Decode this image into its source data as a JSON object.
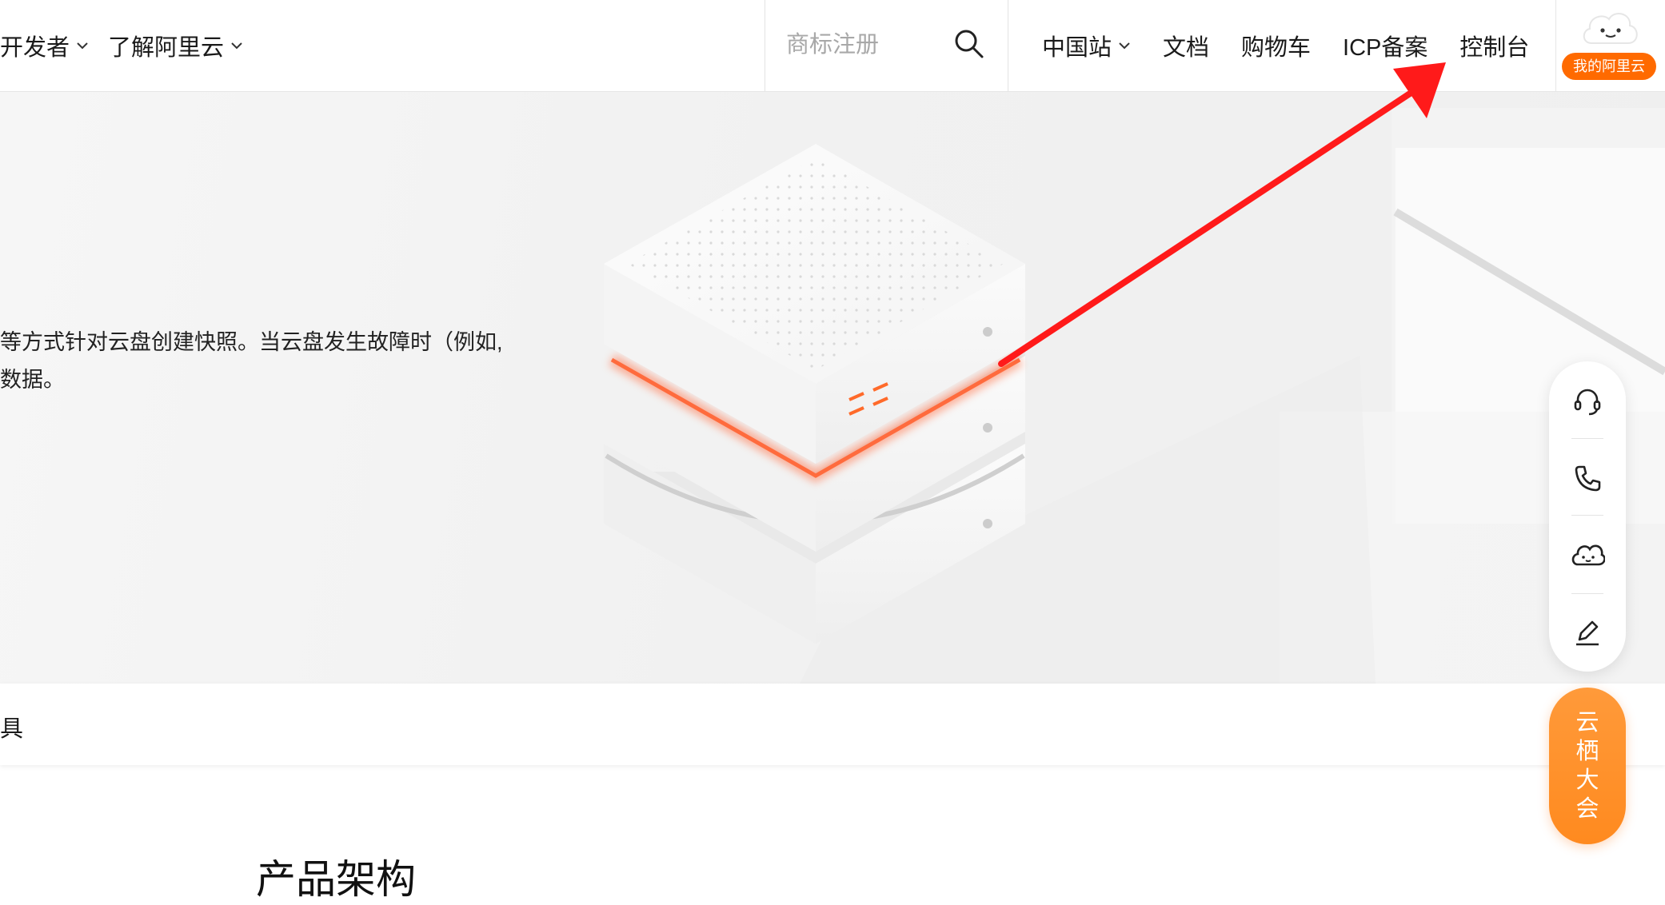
{
  "nav": {
    "left_items": [
      {
        "label": "开发者",
        "icon": "chevron-down-icon"
      },
      {
        "label": "了解阿里云",
        "icon": "chevron-down-icon"
      }
    ],
    "search": {
      "placeholder": "商标注册",
      "icon": "search-icon"
    },
    "right_items": [
      {
        "label": "中国站",
        "icon": "chevron-down-icon"
      },
      {
        "label": "文档"
      },
      {
        "label": "购物车"
      },
      {
        "label": "ICP备案"
      },
      {
        "label": "控制台"
      }
    ],
    "profile": {
      "badge": "我的阿里云",
      "icon": "mascot-cloud-icon"
    }
  },
  "hero": {
    "description_lines": [
      "等方式针对云盘创建快照。当云盘发生故障时（例如,",
      "数据。"
    ]
  },
  "tabs": [
    {
      "label": "具"
    }
  ],
  "section": {
    "title": "产品架构"
  },
  "float_tools": [
    {
      "icon": "headset-icon"
    },
    {
      "icon": "phone-icon"
    },
    {
      "icon": "cloud-face-icon"
    },
    {
      "icon": "edit-icon"
    }
  ],
  "promo": {
    "label": [
      "云",
      "栖",
      "大",
      "会"
    ]
  },
  "annotation": {
    "arrow_color": "#ff1a1a",
    "target": "控制台"
  },
  "colors": {
    "brand": "#ff6a00",
    "accent_glow": "#ff6b3d"
  }
}
